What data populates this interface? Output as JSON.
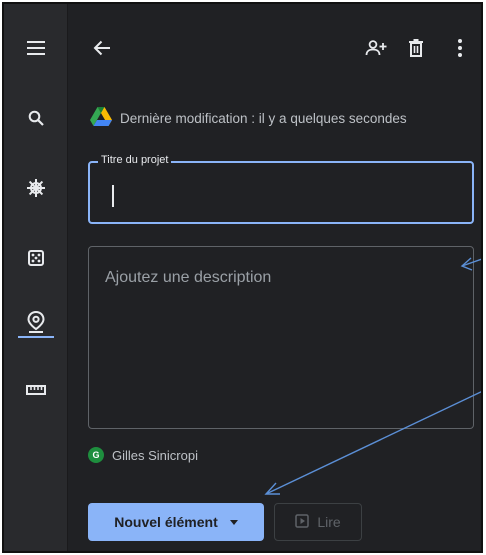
{
  "toolbar": {
    "back_icon": "arrow-left-icon",
    "share_icon": "person-add-icon",
    "delete_icon": "trash-icon",
    "more_icon": "more-vert-icon"
  },
  "sidebar": {
    "items": [
      {
        "icon": "menu-icon"
      },
      {
        "icon": "search-icon"
      },
      {
        "icon": "ship-wheel-icon"
      },
      {
        "icon": "dice-icon"
      },
      {
        "icon": "place-pin-icon",
        "active": true
      },
      {
        "icon": "ruler-icon"
      }
    ]
  },
  "project": {
    "last_modified": "Dernière modification : il y a quelques secondes",
    "title_label": "Titre du projet",
    "title_value": "",
    "description_placeholder": "Ajoutez une description",
    "author_initial": "G",
    "author_name": "Gilles Sinicropi"
  },
  "actions": {
    "new_item_label": "Nouvel élément",
    "play_label": "Lire"
  },
  "colors": {
    "accent": "#8ab4f8",
    "background": "#202124",
    "rail": "#292a2d",
    "annotation": "#5b8fd6"
  }
}
